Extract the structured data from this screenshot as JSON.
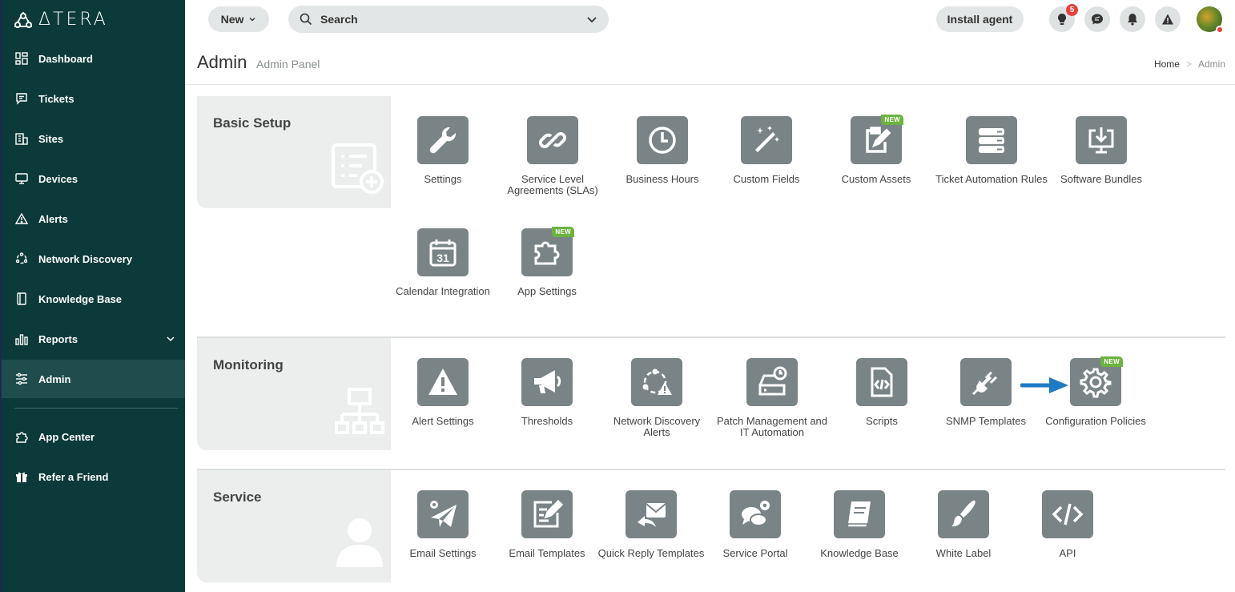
{
  "brand": {
    "name": "ΔTERA"
  },
  "sidebar": {
    "items": [
      {
        "label": "Dashboard",
        "icon": "dashboard-icon"
      },
      {
        "label": "Tickets",
        "icon": "ticket-icon"
      },
      {
        "label": "Sites",
        "icon": "building-icon"
      },
      {
        "label": "Devices",
        "icon": "monitor-icon"
      },
      {
        "label": "Alerts",
        "icon": "warning-icon"
      },
      {
        "label": "Network Discovery",
        "icon": "network-icon"
      },
      {
        "label": "Knowledge Base",
        "icon": "book-icon"
      },
      {
        "label": "Reports",
        "icon": "bar-chart-icon"
      },
      {
        "label": "Admin",
        "icon": "sliders-icon",
        "active": true
      },
      {
        "label": "App Center",
        "icon": "puzzle-icon"
      },
      {
        "label": "Refer a Friend",
        "icon": "gift-icon"
      }
    ]
  },
  "topbar": {
    "new_label": "New",
    "search_placeholder": "Search",
    "install_label": "Install agent",
    "notifications_count": "5"
  },
  "header": {
    "title": "Admin",
    "subtitle": "Admin Panel",
    "breadcrumb": {
      "home": "Home",
      "sep": ">",
      "current": "Admin"
    }
  },
  "sections": {
    "basic": {
      "title": "Basic Setup",
      "tiles": [
        {
          "label": "Settings",
          "icon": "wrench-icon"
        },
        {
          "label": "Service Level Agreements (SLAs)",
          "icon": "link-icon"
        },
        {
          "label": "Business Hours",
          "icon": "clock-icon"
        },
        {
          "label": "Custom Fields",
          "icon": "magic-wand-icon"
        },
        {
          "label": "Custom Assets",
          "icon": "clipboard-edit-icon",
          "badge": "NEW"
        },
        {
          "label": "Ticket Automation Rules",
          "icon": "server-stack-icon"
        },
        {
          "label": "Software Bundles",
          "icon": "download-monitor-icon"
        },
        {
          "label": "Calendar Integration",
          "icon": "calendar-icon",
          "date": "31"
        },
        {
          "label": "App Settings",
          "icon": "puzzle-icon",
          "badge": "NEW"
        }
      ]
    },
    "monitoring": {
      "title": "Monitoring",
      "tiles": [
        {
          "label": "Alert Settings",
          "icon": "warning-icon"
        },
        {
          "label": "Thresholds",
          "icon": "megaphone-icon"
        },
        {
          "label": "Network Discovery Alerts",
          "icon": "network-alert-icon"
        },
        {
          "label": "Patch Management and IT Automation",
          "icon": "drive-clock-icon"
        },
        {
          "label": "Scripts",
          "icon": "code-file-icon"
        },
        {
          "label": "SNMP Templates",
          "icon": "plug-icon"
        },
        {
          "label": "Configuration Policies",
          "icon": "gear-icon",
          "badge": "NEW"
        }
      ]
    },
    "service": {
      "title": "Service",
      "tiles": [
        {
          "label": "Email Settings",
          "icon": "paper-plane-gear-icon"
        },
        {
          "label": "Email Templates",
          "icon": "template-edit-icon"
        },
        {
          "label": "Quick Reply Templates",
          "icon": "reply-mail-icon"
        },
        {
          "label": "Service Portal",
          "icon": "chat-gear-icon"
        },
        {
          "label": "Knowledge Base",
          "icon": "book-icon"
        },
        {
          "label": "White Label",
          "icon": "brush-icon"
        },
        {
          "label": "API",
          "icon": "code-icon"
        }
      ]
    }
  },
  "colors": {
    "sidebar_bg": "#0c3a3a",
    "tile_bg": "#7a8386",
    "new_badge": "#6cb33f",
    "arrow": "#1f7ac4"
  }
}
